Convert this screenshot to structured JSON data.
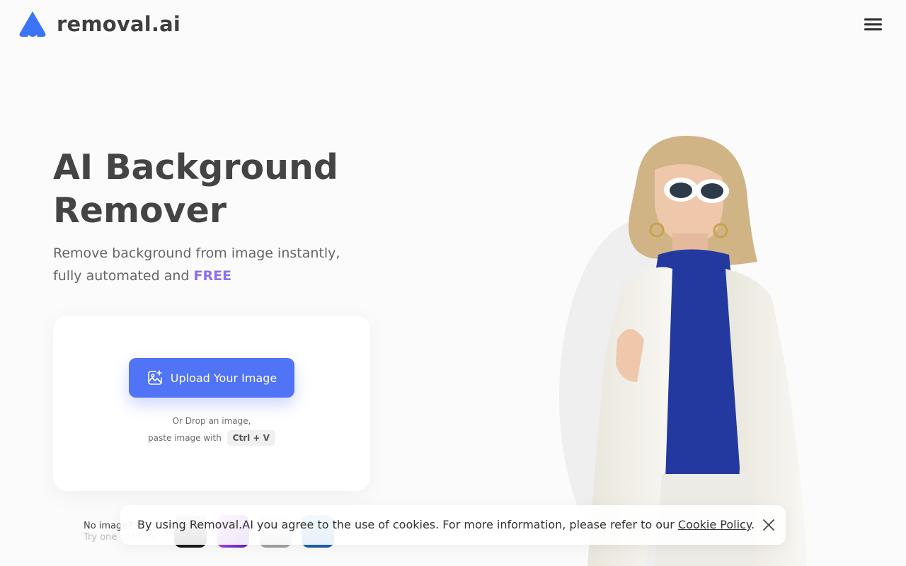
{
  "header": {
    "logo_text": "removal.ai",
    "brand_color": "#3b74f6"
  },
  "hero": {
    "title_line1": "AI Background",
    "title_line2": "Remover",
    "subtitle_line1": "Remove background from image instantly,",
    "subtitle_line2_prefix": "fully automated and ",
    "subtitle_free": "FREE",
    "accent_color": "#8b6ff0"
  },
  "upload": {
    "button_label": "Upload Your Image",
    "button_color": "#5173f5",
    "drop_line1": "Or Drop an image,",
    "drop_line2": "paste image with",
    "shortcut": "Ctrl + V",
    "icon": "image-upload-icon"
  },
  "samples": {
    "label_line1": "No image?",
    "label_line2": "Try one of these"
  },
  "cookie": {
    "text": "By using Removal.AI you agree to the use of cookies. For more information, please refer to our ",
    "link": "Cookie Policy",
    "suffix": "."
  },
  "icons": {
    "menu": "hamburger-menu-icon",
    "close": "close-icon",
    "logo": "removal-logo-icon"
  }
}
